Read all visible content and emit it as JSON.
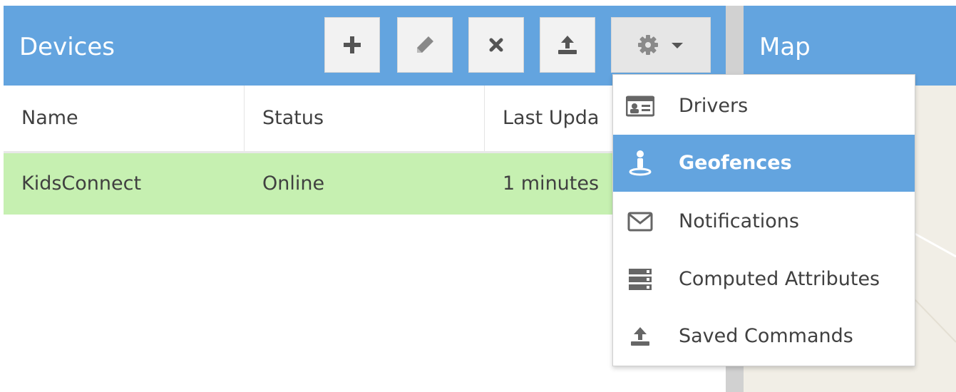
{
  "devices_panel": {
    "title": "Devices",
    "header_color": "#63a4df",
    "toolbar": [
      {
        "id": "add",
        "icon": "plus-icon"
      },
      {
        "id": "edit",
        "icon": "pencil-icon"
      },
      {
        "id": "remove",
        "icon": "times-icon"
      },
      {
        "id": "export",
        "icon": "upload-icon"
      },
      {
        "id": "settings",
        "icon": "gear-icon",
        "caret": "chevron-down-icon"
      }
    ],
    "columns": [
      "Name",
      "Status",
      "Last Upda"
    ],
    "rows": [
      {
        "name": "KidsConnect",
        "status": "Online",
        "last_update": "1 minutes",
        "highlight_color": "#c6f0b1"
      }
    ]
  },
  "map_panel": {
    "title": "Map"
  },
  "settings_menu": {
    "active_color": "#63a4df",
    "items": [
      {
        "label": "Drivers",
        "icon": "id-card-icon",
        "active": false
      },
      {
        "label": "Geofences",
        "icon": "map-pin-person-icon",
        "active": true
      },
      {
        "label": "Notifications",
        "icon": "envelope-icon",
        "active": false
      },
      {
        "label": "Computed Attributes",
        "icon": "server-stack-icon",
        "active": false
      },
      {
        "label": "Saved Commands",
        "icon": "upload-icon",
        "active": false
      }
    ]
  }
}
